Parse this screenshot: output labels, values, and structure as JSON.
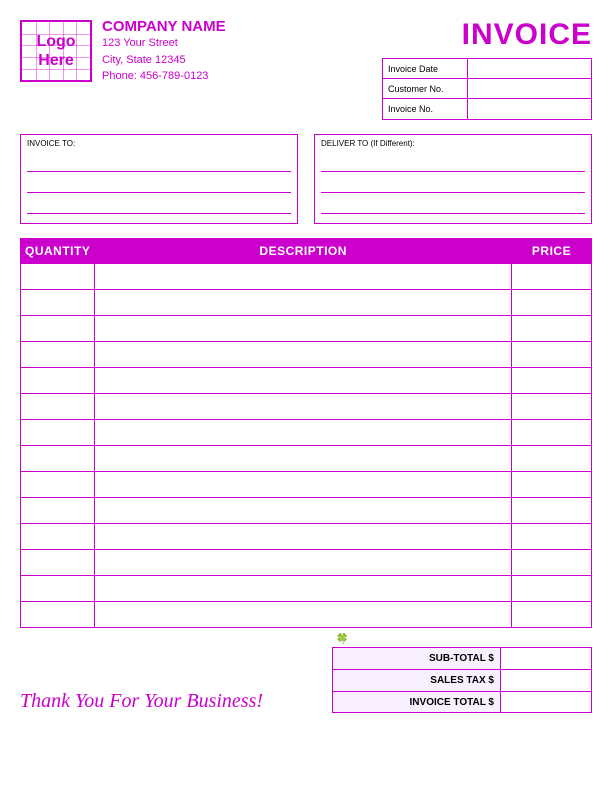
{
  "header": {
    "logo": {
      "line1": "Logo",
      "line2": "Here"
    },
    "company": {
      "name": "COMPANY NAME",
      "address1": "123 Your Street",
      "address2": "City, State 12345",
      "phone": "Phone: 456-789-0123"
    },
    "invoice_title": "INVOICE",
    "fields": [
      {
        "label": "Invoice Date"
      },
      {
        "label": "Customer No."
      },
      {
        "label": "Invoice No."
      }
    ]
  },
  "address": {
    "invoice_to_label": "INVOICE TO:",
    "deliver_to_label": "DELIVER TO (If Different):"
  },
  "table": {
    "headers": {
      "quantity": "QUANTITY",
      "description": "DESCRIPTION",
      "price": "PRICE"
    },
    "row_count": 14
  },
  "footer": {
    "thank_you": "Thank You For Your Business!",
    "totals": [
      {
        "label": "SUB-TOTAL $"
      },
      {
        "label": "SALES TAX $"
      },
      {
        "label": "INVOICE TOTAL $"
      }
    ]
  }
}
